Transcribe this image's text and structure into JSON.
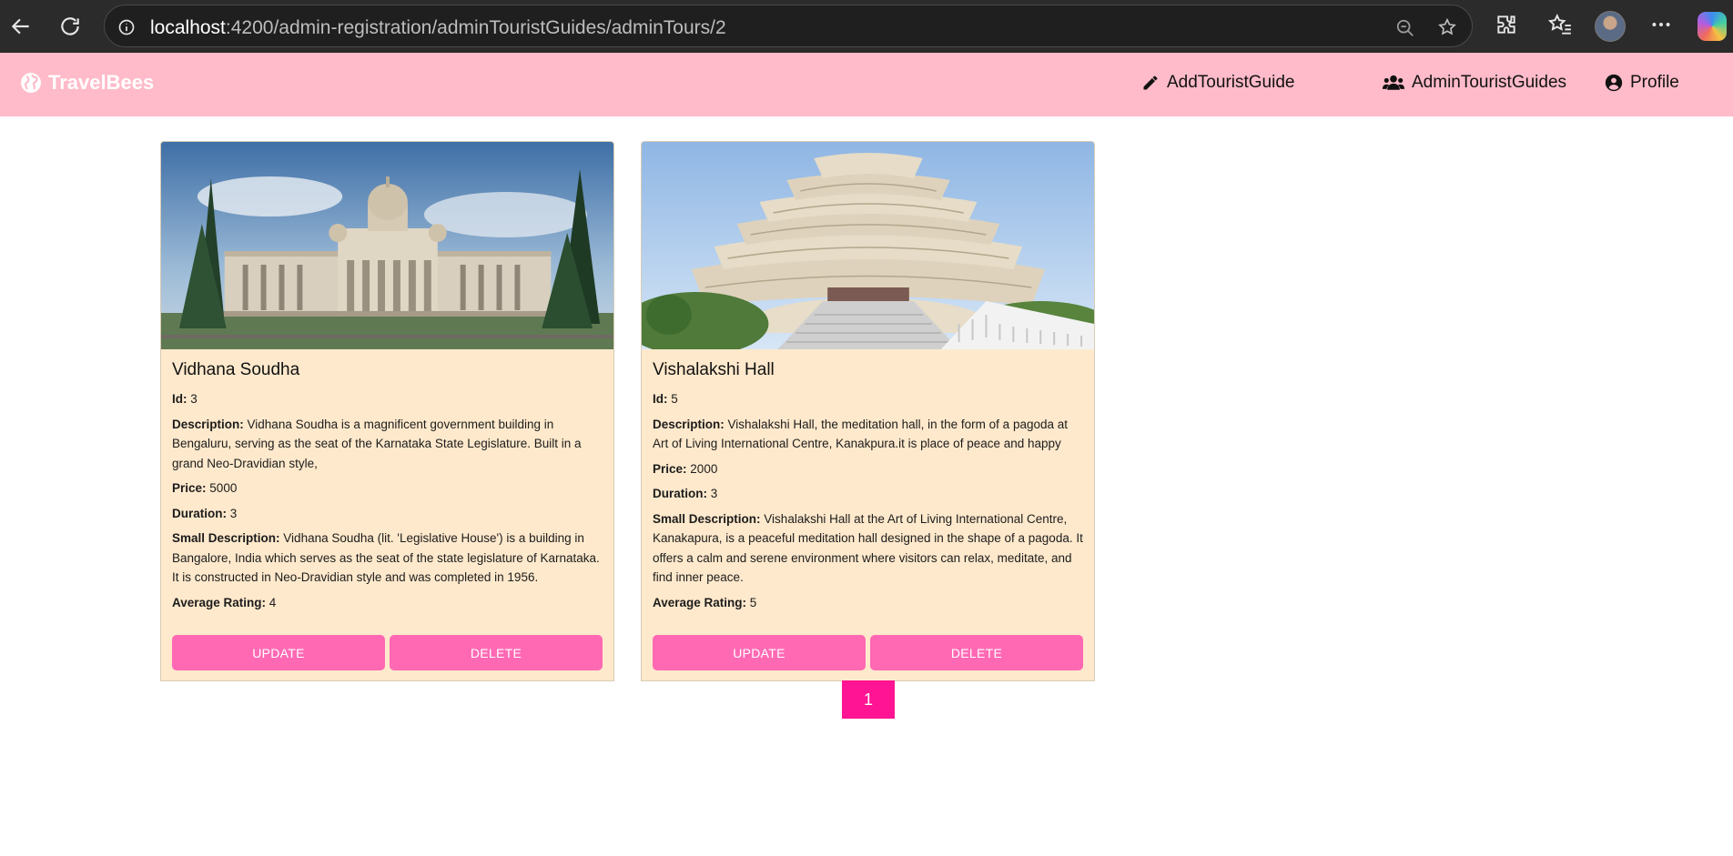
{
  "browser": {
    "url_host": "localhost",
    "url_rest": ":4200/admin-registration/adminTouristGuides/adminTours/2"
  },
  "navbar": {
    "brand": "TravelBees",
    "links": [
      {
        "label": "AddTouristGuide",
        "icon": "pencil-icon"
      },
      {
        "label": "AdminTouristGuides",
        "icon": "users-icon"
      },
      {
        "label": "Profile",
        "icon": "user-circle-icon"
      }
    ]
  },
  "labels": {
    "id": "Id:",
    "description": "Description:",
    "price": "Price:",
    "duration": "Duration:",
    "small_description": "Small Description:",
    "average_rating": "Average Rating:",
    "update": "Update",
    "delete": "Delete"
  },
  "tours": [
    {
      "title": "Vidhana Soudha",
      "id": "3",
      "description": "Vidhana Soudha is a magnificent government building in Bengaluru, serving as the seat of the Karnataka State Legislature. Built in a grand Neo-Dravidian style,",
      "price": "5000",
      "duration": "3",
      "small_description": "Vidhana Soudha (lit. 'Legislative House') is a building in Bangalore, India which serves as the seat of the state legislature of Karnataka. It is constructed in Neo-Dravidian style and was completed in 1956.",
      "average_rating": "4"
    },
    {
      "title": "Vishalakshi Hall",
      "id": "5",
      "description": "Vishalakshi Hall, the meditation hall, in the form of a pagoda at Art of Living International Centre, Kanakpura.it is place of peace and happy",
      "price": "2000",
      "duration": "3",
      "small_description": "Vishalakshi Hall at the Art of Living International Centre, Kanakapura, is a peaceful meditation hall designed in the shape of a pagoda. It offers a calm and serene environment where visitors can relax, meditate, and find inner peace.",
      "average_rating": "5"
    }
  ],
  "pagination": {
    "current": "1"
  },
  "colors": {
    "navbar": "#ffbbc9",
    "card": "#ffe9cc",
    "button": "#ff69b4",
    "page_active": "#ff1493"
  }
}
